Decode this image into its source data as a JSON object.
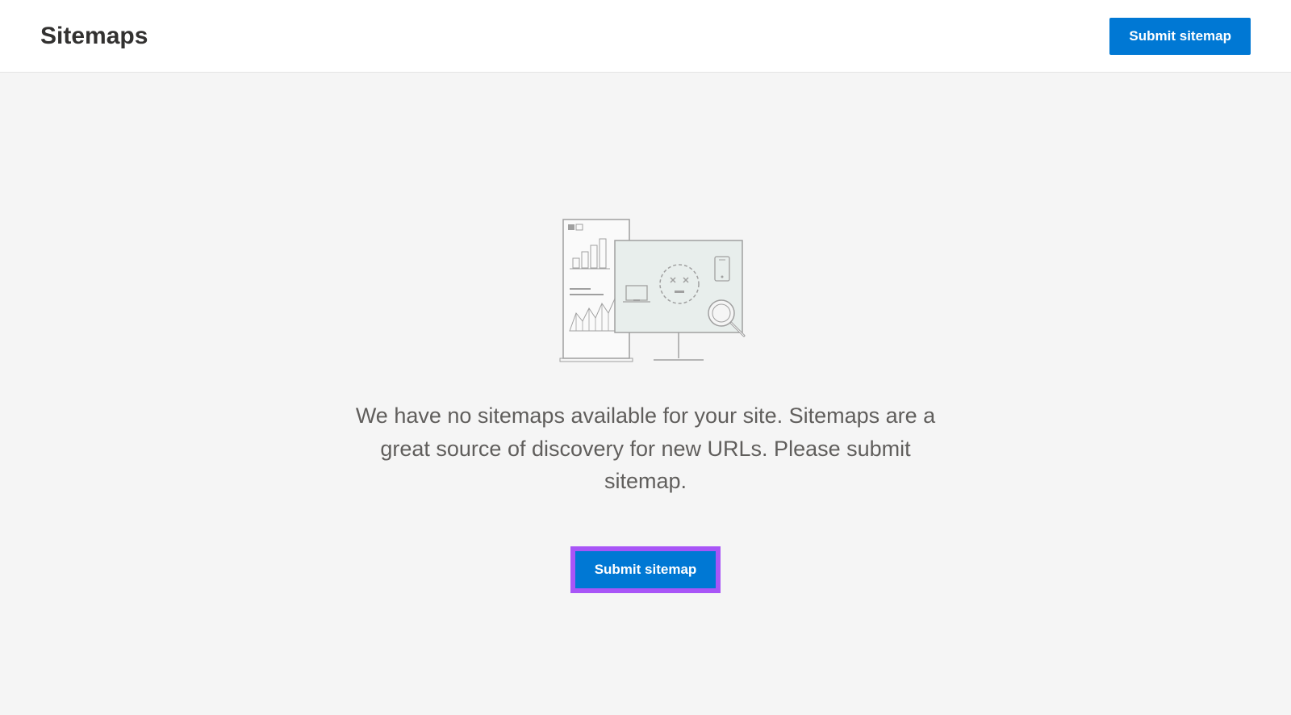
{
  "header": {
    "title": "Sitemaps",
    "submit_button_label": "Submit sitemap"
  },
  "empty_state": {
    "message": "We have no sitemaps available for your site. Sitemaps are a great source of discovery for new URLs. Please submit sitemap.",
    "submit_button_label": "Submit sitemap"
  }
}
